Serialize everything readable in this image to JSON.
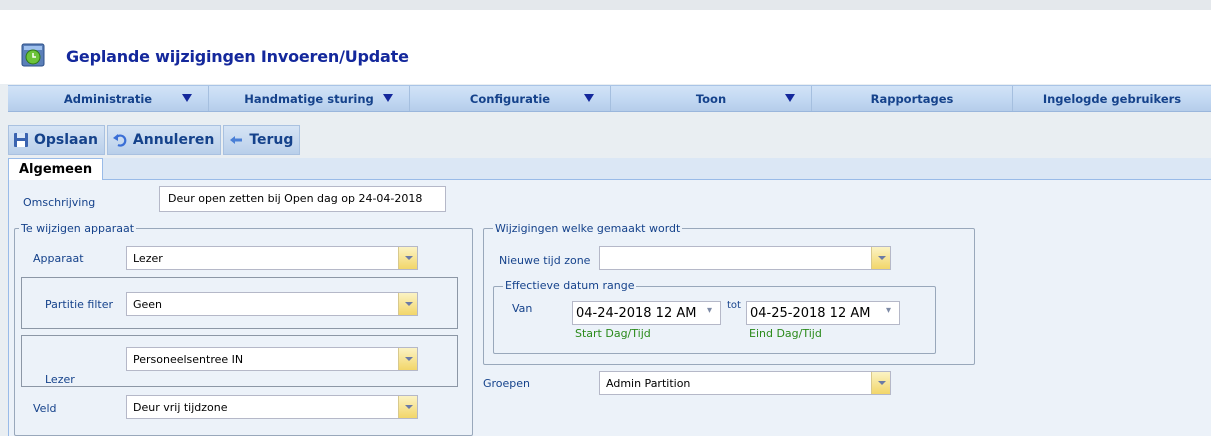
{
  "header": {
    "title": "Geplande wijzigingen Invoeren/Update"
  },
  "menu": [
    {
      "label": "Administratie",
      "has_arrow": true
    },
    {
      "label": "Handmatige sturing",
      "has_arrow": true
    },
    {
      "label": "Configuratie",
      "has_arrow": true
    },
    {
      "label": "Toon",
      "has_arrow": true
    },
    {
      "label": "Rapportages",
      "has_arrow": false
    },
    {
      "label": "Ingelogde gebruikers",
      "has_arrow": false
    }
  ],
  "toolbar": {
    "save_label": "Opslaan",
    "cancel_label": "Annuleren",
    "back_label": "Terug"
  },
  "tabs": [
    {
      "label": "Algemeen",
      "active": true
    }
  ],
  "form": {
    "description_label": "Omschrijving",
    "description_value": "Deur open zetten bij Open dag op 24-04-2018",
    "device_group": {
      "legend": "Te wijzigen apparaat",
      "device_label": "Apparaat",
      "device_value": "Lezer",
      "partition_filter_label": "Partitie filter",
      "partition_filter_value": "Geen",
      "reader_label": "Lezer",
      "reader_value": "Personeelsentree IN",
      "field_label": "Veld",
      "field_value": "Deur vrij tijdzone"
    },
    "changes_group": {
      "legend": "Wijzigingen welke gemaakt wordt",
      "new_timezone_label": "Nieuwe tijd zone",
      "new_timezone_value": "",
      "date_range": {
        "legend": "Effectieve datum range",
        "from_label": "Van",
        "from_value": "04-24-2018 12 AM",
        "from_hint": "Start Dag/Tijd",
        "to_label": "tot",
        "to_value": "04-25-2018 12 AM",
        "to_hint": "Eind Dag/Tijd"
      }
    },
    "groups_label": "Groepen",
    "groups_value": "Admin Partition"
  },
  "colors": {
    "menu_text": "#15428b",
    "title_text": "#14289c",
    "hint_green": "#2a8a1a",
    "trigger_yellow": "#f2d66a"
  }
}
